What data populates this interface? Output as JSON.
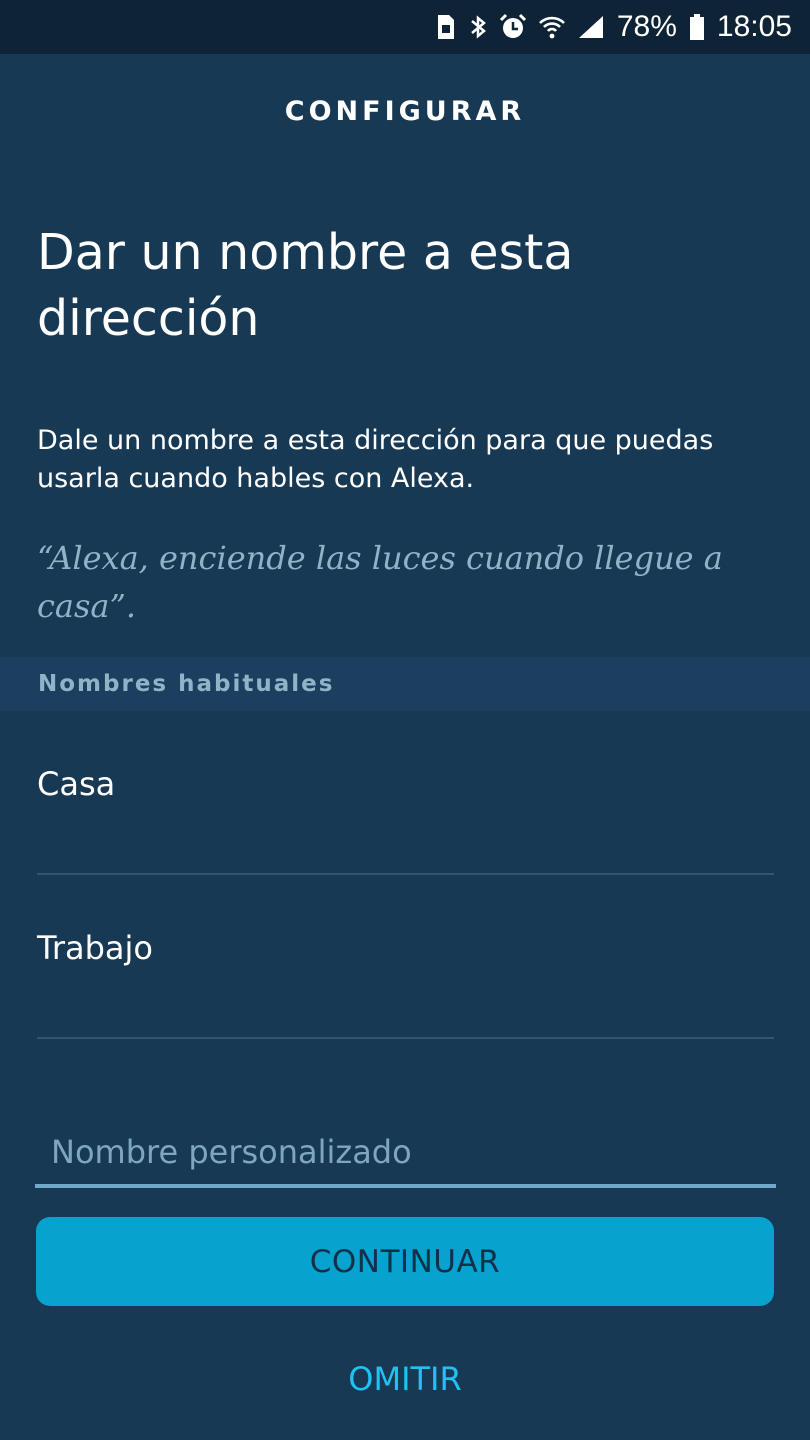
{
  "status_bar": {
    "battery_percent": "78%",
    "time": "18:05",
    "icons": [
      "sim-icon",
      "bluetooth-icon",
      "alarm-icon",
      "wifi-icon",
      "signal-icon",
      "battery-icon"
    ]
  },
  "header": {
    "title": "CONFIGURAR"
  },
  "main": {
    "heading": "Dar un nombre a esta dirección",
    "description": "Dale un nombre a esta dirección para que puedas usarla cuando hables con Alexa.",
    "example": "“Alexa, enciende las luces cuando llegue a casa”.",
    "section_title": "Nombres habituales",
    "options": [
      {
        "label": "Casa"
      },
      {
        "label": "Trabajo"
      }
    ],
    "custom_name": {
      "value": "",
      "placeholder": "Nombre personalizado"
    },
    "continue_label": "CONTINUAR",
    "skip_label": "OMITIR"
  },
  "colors": {
    "background": "#183954",
    "status_bar": "#0e2336",
    "section_header_bg": "#1c3f60",
    "muted_text": "#8fb3c7",
    "button": "#08a2cf",
    "link": "#1ec2f3"
  }
}
